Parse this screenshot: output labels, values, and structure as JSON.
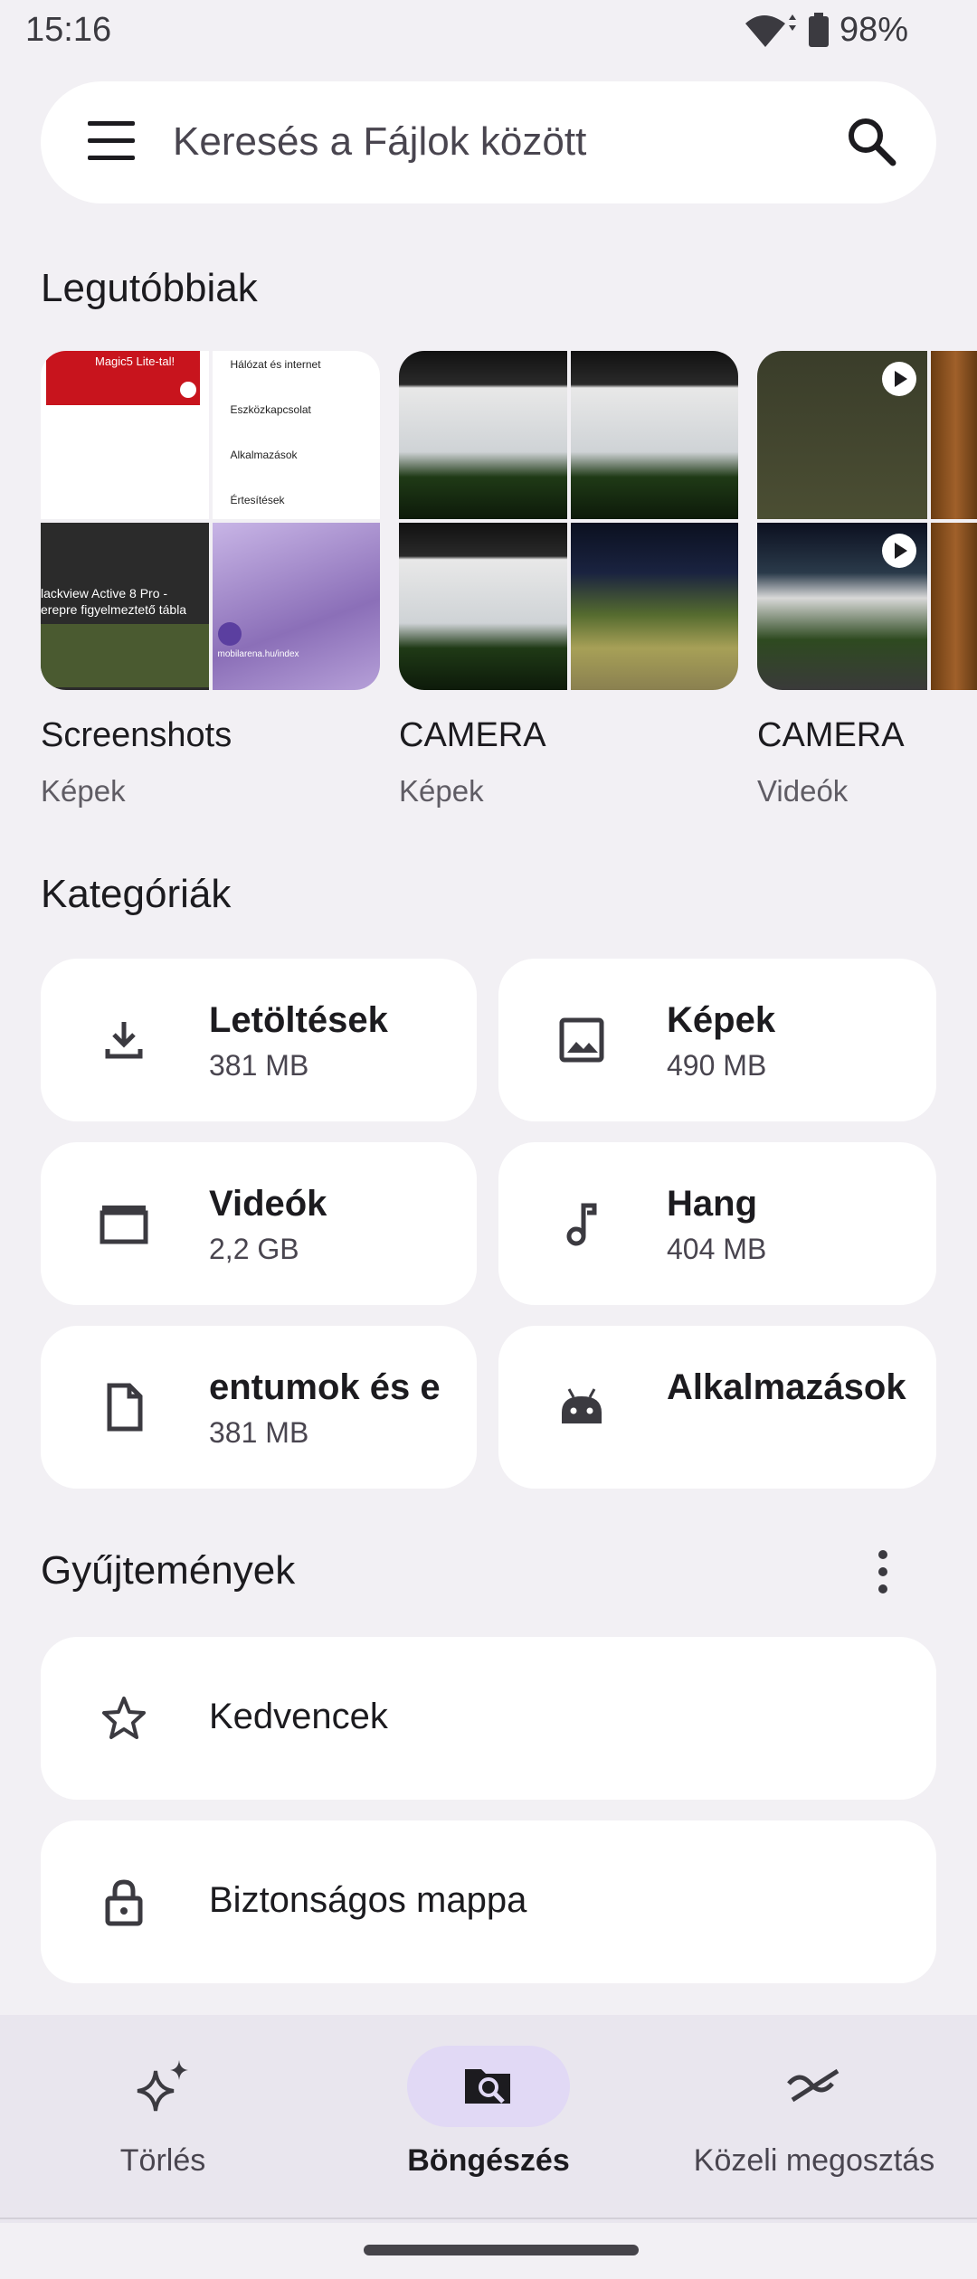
{
  "status_bar": {
    "time": "15:16",
    "battery": "98%"
  },
  "search": {
    "placeholder": "Keresés a Fájlok között"
  },
  "recent": {
    "title": "Legutóbbiak",
    "items": [
      {
        "name": "Screenshots",
        "type": "Képek"
      },
      {
        "name": "CAMERA",
        "type": "Képek"
      },
      {
        "name": "CAMERA",
        "type": "Videók"
      }
    ],
    "screenshot_texts": {
      "a": "Hálózat és internet",
      "b": "Eszközkapcsolat",
      "c": "Alkalmazások",
      "d": "Értesítések",
      "e": "lackview Active 8 Pro -",
      "f": "erepre figyelmeztető tábla",
      "g": "mobilarena.hu/index",
      "h": "Magic5 Lite-tal!"
    }
  },
  "categories": {
    "title": "Kategóriák",
    "items": [
      {
        "name": "Letöltések",
        "size": "381 MB",
        "icon": "download-icon"
      },
      {
        "name": "Képek",
        "size": "490 MB",
        "icon": "image-icon"
      },
      {
        "name": "Videók",
        "size": "2,2 GB",
        "icon": "movie-icon"
      },
      {
        "name": "Hang",
        "size": "404 MB",
        "icon": "music-note-icon"
      },
      {
        "name": "entumok és e",
        "size": "381 MB",
        "icon": "document-icon"
      },
      {
        "name": "Alkalmazások",
        "size": "",
        "icon": "android-icon"
      }
    ]
  },
  "collections": {
    "title": "Gyűjtemények",
    "items": [
      {
        "name": "Kedvencek",
        "icon": "star-icon"
      },
      {
        "name": "Biztonságos mappa",
        "icon": "lock-icon"
      }
    ]
  },
  "bottom_nav": {
    "items": [
      {
        "label": "Törlés",
        "icon": "sparkle-icon"
      },
      {
        "label": "Böngészés",
        "icon": "folder-search-icon",
        "active": true
      },
      {
        "label": "Közeli megosztás",
        "icon": "nearby-share-icon"
      }
    ]
  },
  "colors": {
    "background": "#f2f0f4",
    "card": "#ffffff",
    "active_pill": "#e1d9f5"
  }
}
